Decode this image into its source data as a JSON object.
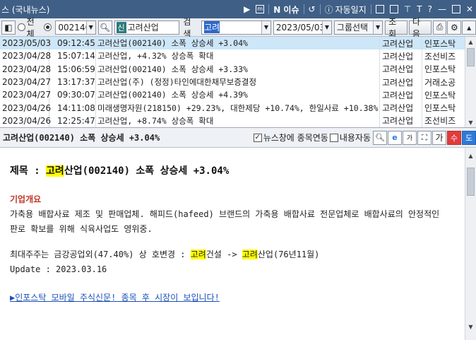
{
  "window": {
    "title": "스 (국내뉴스)",
    "buttons": [
      "N 이슈",
      "자동일지"
    ]
  },
  "toolbar": {
    "radio_all": "전체",
    "stock_code": "002140",
    "stock_badge": "신",
    "stock_name": "고려산업",
    "search_label": "검색",
    "search_value": "고려",
    "date": "2023/05/03",
    "group_select": "그룹선택",
    "query_button": "조회",
    "next_button": "다음"
  },
  "news_list": [
    {
      "date": "2023/05/03",
      "time": "09:12:45",
      "title": "고려산업(002140) 소폭 상승세 +3.04%",
      "item": "고려산업",
      "source": "인포스탁",
      "selected": true
    },
    {
      "date": "2023/04/28",
      "time": "15:07:14",
      "title": "고려산업, +4.32% 상승폭 확대",
      "item": "고려산업",
      "source": "조선비즈"
    },
    {
      "date": "2023/04/28",
      "time": "15:06:59",
      "title": "고려산업(002140) 소폭 상승세 +3.33%",
      "item": "고려산업",
      "source": "인포스탁"
    },
    {
      "date": "2023/04/27",
      "time": "13:17:37",
      "title": "고려산업(주) (정정)타인에대한채무보증결정",
      "item": "고려산업",
      "source": "거래소공"
    },
    {
      "date": "2023/04/27",
      "time": "09:30:07",
      "title": "고려산업(002140) 소폭 상승세 +4.39%",
      "item": "고려산업",
      "source": "인포스탁"
    },
    {
      "date": "2023/04/26",
      "time": "14:11:08",
      "title": "미래생명자원(218150) +29.23%, 대한제당 +10.74%, 한일사료 +10.38%,",
      "item": "고려산업",
      "source": "인포스탁"
    },
    {
      "date": "2023/04/26",
      "time": "12:25:47",
      "title": "고려산업, +8.74% 상승폭 확대",
      "item": "고려산업",
      "source": "조선비즈"
    }
  ],
  "detail": {
    "header_title": "고려산업(002140) 소폭 상승세 +3.04%",
    "checkbox_link": "뉴스창에 종목연동",
    "checkbox_auto": "내용자동",
    "font_small": "가",
    "font_large": "가",
    "edit_button": "수",
    "blue_button": "도",
    "headline_prefix": "제목 : ",
    "headline_hl": "고려",
    "headline_rest": "산업(002140) 소폭 상승세 +3.04%",
    "section_title": "기업개요",
    "para1_line1": "가축용 배합사료 제조 및 판매업체. 해피드(hafeed) 브랜드의 가축용 배합사료 전문업체로 배합사료의 안정적인",
    "para1_line2": "판로 확보를 위해 식육사업도 영위중.",
    "shareholder_prefix": "최대주주는 금강공업외(47.40%) 상 호변경 : ",
    "shareholder_hl1": "고려",
    "shareholder_mid": "건설 -> ",
    "shareholder_hl2": "고려",
    "shareholder_suffix": "산업(76년11월)",
    "update": "Update : 2023.03.16",
    "link_text": "▶인포스탁 모바일 주식신문! 종목 후 시장이 보입니다!"
  },
  "colors": {
    "titlebar": "#3f5f86",
    "selected_row": "#cde6f8",
    "highlight": "#ffff00",
    "section": "#c0392b",
    "link": "#1b4fb8"
  }
}
